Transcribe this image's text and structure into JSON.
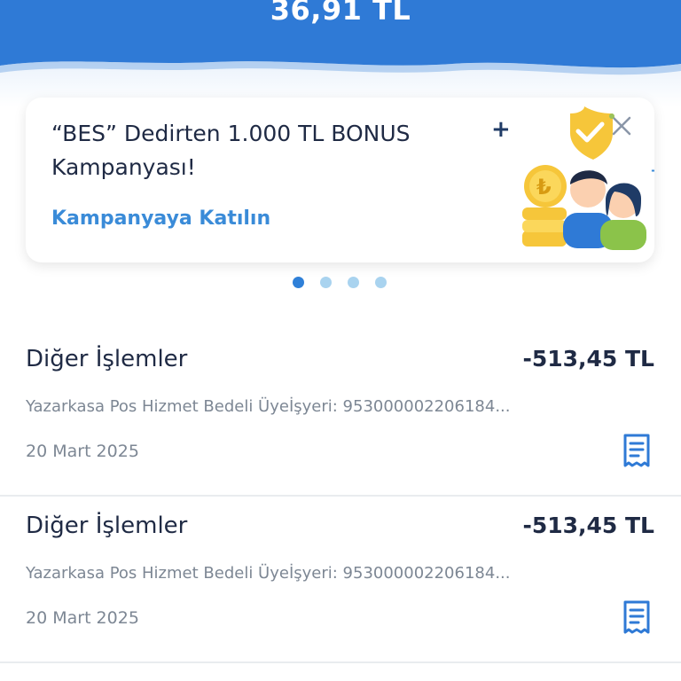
{
  "header": {
    "balance": "36,91 TL",
    "color": "#2f7ad6"
  },
  "promo": {
    "title": "“BES” Dedirten 1.000 TL BONUS Kampanyası!",
    "link_label": "Kampanyaya Katılın",
    "close_icon": "close-icon",
    "illustration": "coin-and-people-illustration",
    "coin_symbol": "₺"
  },
  "carousel": {
    "count": 4,
    "active_index": 0
  },
  "transactions": [
    {
      "title": "Diğer İşlemler",
      "amount": "-513,45 TL",
      "description": "Yazarkasa Pos Hizmet Bedeli Üyeİşyeri: 953000002206184...",
      "date": "20 Mart 2025",
      "icon": "receipt-icon"
    },
    {
      "title": "Diğer İşlemler",
      "amount": "-513,45 TL",
      "description": "Yazarkasa Pos Hizmet Bedeli Üyeİşyeri: 953000002206184...",
      "date": "20 Mart 2025",
      "icon": "receipt-icon"
    }
  ]
}
